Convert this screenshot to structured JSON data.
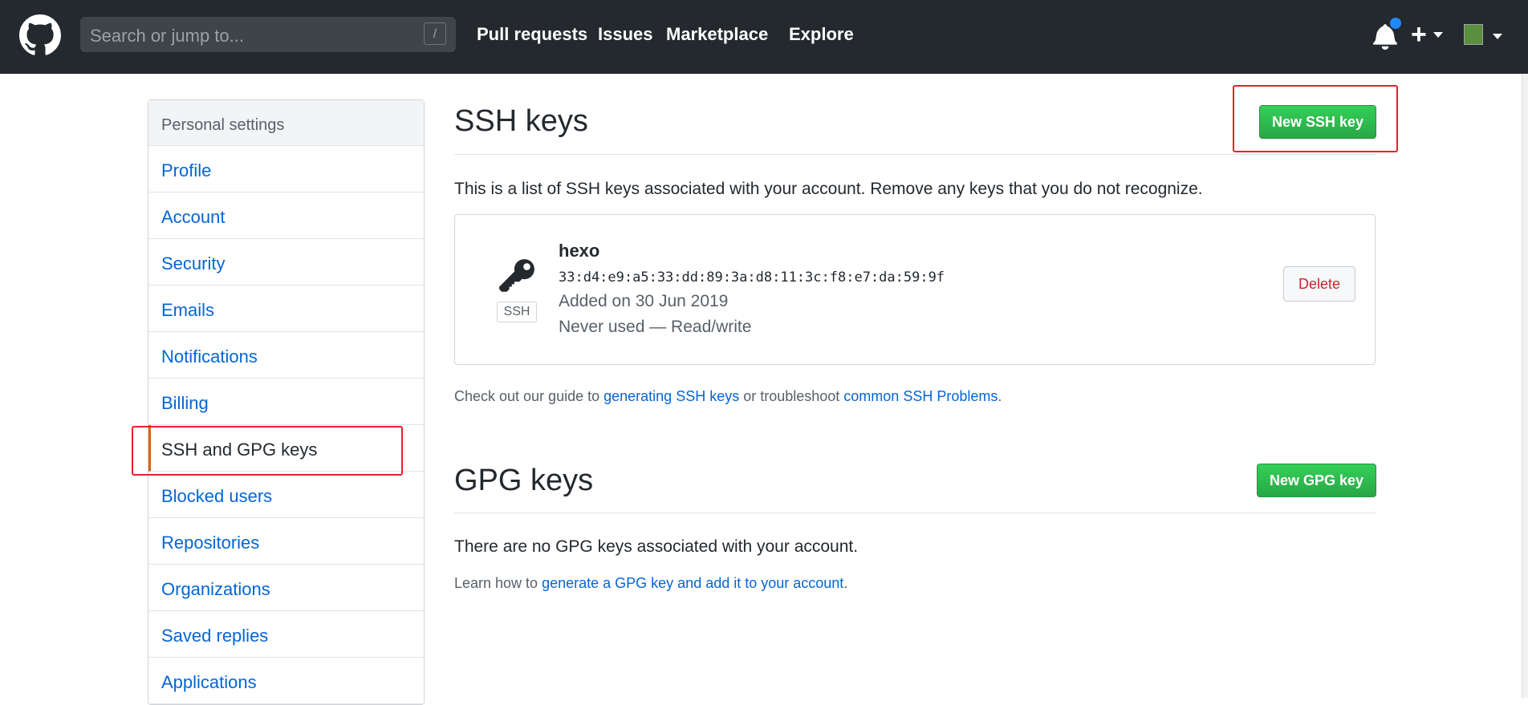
{
  "header": {
    "search_placeholder": "Search or jump to...",
    "search_shortcut": "/",
    "nav": [
      "Pull requests",
      "Issues",
      "Marketplace",
      "Explore"
    ],
    "brand_color": "#24292e",
    "notification_dot_color": "#2188ff"
  },
  "sidebar": {
    "header": "Personal settings",
    "items": [
      {
        "label": "Profile"
      },
      {
        "label": "Account"
      },
      {
        "label": "Security"
      },
      {
        "label": "Emails"
      },
      {
        "label": "Notifications"
      },
      {
        "label": "Billing"
      },
      {
        "label": "SSH and GPG keys",
        "selected": true
      },
      {
        "label": "Blocked users"
      },
      {
        "label": "Repositories"
      },
      {
        "label": "Organizations"
      },
      {
        "label": "Saved replies"
      },
      {
        "label": "Applications"
      }
    ],
    "highlight_color": "#e8202a"
  },
  "ssh": {
    "title": "SSH keys",
    "new_button": "New SSH key",
    "description": "This is a list of SSH keys associated with your account. Remove any keys that you do not recognize.",
    "key": {
      "name": "hexo",
      "fingerprint": "33:d4:e9:a5:33:dd:89:3a:d8:11:3c:f8:e7:da:59:9f",
      "added": "Added on 30 Jun 2019",
      "usage": "Never used — Read/write",
      "badge": "SSH",
      "icon": "key-icon"
    },
    "delete_button": "Delete",
    "help": {
      "prefix": "Check out our guide to ",
      "link1": "generating SSH keys",
      "middle": " or troubleshoot ",
      "link2": "common SSH Problems",
      "suffix": "."
    }
  },
  "gpg": {
    "title": "GPG keys",
    "new_button": "New GPG key",
    "empty_text": "There are no GPG keys associated with your account.",
    "learn_prefix": "Learn how to ",
    "learn_link": "generate a GPG key and add it to your account",
    "learn_suffix": "."
  },
  "colors": {
    "green_button": "#2ea44f",
    "link": "#0366d6",
    "danger": "#cb2431"
  }
}
